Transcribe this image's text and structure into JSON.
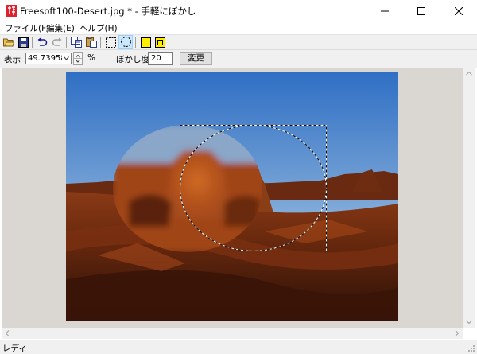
{
  "window": {
    "title": "Freesoft100-Desert.jpg * - 手軽にぼかし",
    "app_icon": "pen-icon",
    "accent_color": "#e0202c"
  },
  "menu": {
    "items": [
      {
        "label": "ファイル(F)"
      },
      {
        "label": "編集(E)"
      },
      {
        "label": "ヘルプ(H)"
      }
    ]
  },
  "toolbar": {
    "buttons": [
      {
        "icon": "open-folder-icon"
      },
      {
        "icon": "save-icon"
      },
      {
        "icon": "undo-icon"
      },
      {
        "icon": "redo-icon"
      },
      {
        "icon": "copy-icon"
      },
      {
        "icon": "paste-icon"
      },
      {
        "icon": "rect-select-icon"
      },
      {
        "icon": "ellipse-select-icon",
        "active": true
      },
      {
        "icon": "yellow-square-icon"
      },
      {
        "icon": "yellow-small-square-icon"
      }
    ]
  },
  "settings": {
    "zoom_label": "表示",
    "zoom_value": "49.739583",
    "zoom_unit": "%",
    "blur_label": "ぼかし度",
    "blur_value": "20",
    "apply_label": "変更"
  },
  "status": {
    "text": "レディ"
  }
}
